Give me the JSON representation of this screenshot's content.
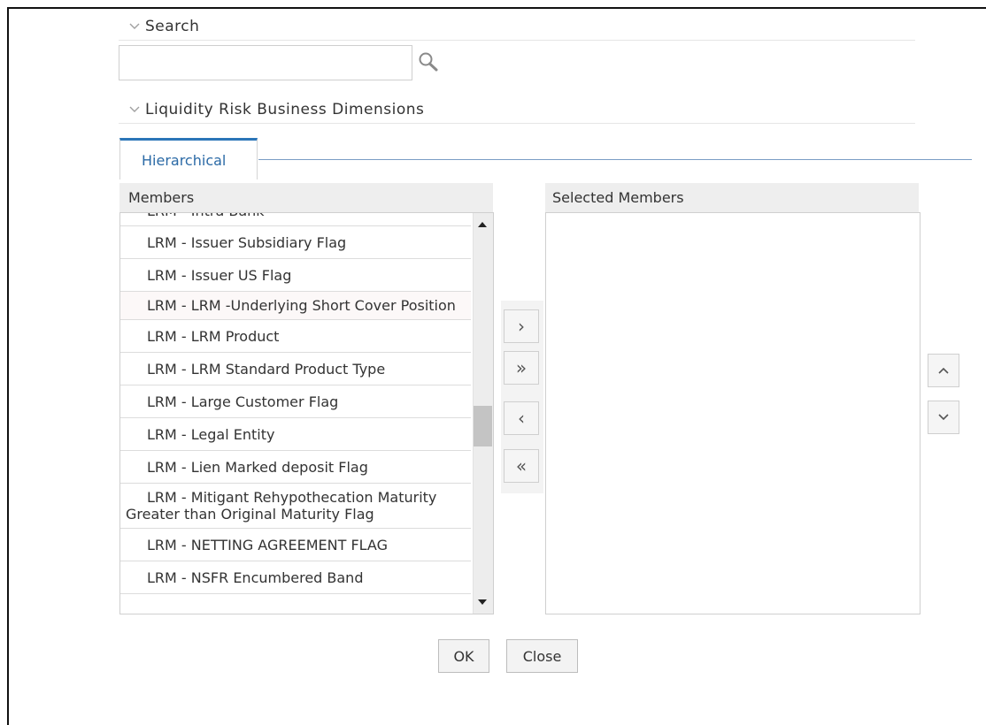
{
  "search_section": {
    "title": "Search",
    "query": "",
    "placeholder": ""
  },
  "dimensions_section": {
    "title": "Liquidity Risk Business Dimensions"
  },
  "tabs": [
    {
      "label": "Hierarchical"
    }
  ],
  "members": {
    "header": "Members",
    "items": [
      "LRM - Intra Bank",
      "LRM - Issuer Subsidiary Flag",
      "LRM - Issuer US Flag",
      "LRM - LRM -Underlying Short Cover Position",
      "LRM - LRM Product",
      "LRM - LRM Standard Product Type",
      "LRM - Large Customer Flag",
      "LRM - Legal Entity",
      "LRM - Lien Marked deposit Flag",
      "LRM - Mitigant Rehypothecation Maturity Greater than Original Maturity Flag",
      "LRM - NETTING AGREEMENT FLAG",
      "LRM - NSFR Encumbered Band"
    ]
  },
  "selected_members": {
    "header": "Selected Members",
    "items": []
  },
  "shuttle": {
    "move": "›",
    "move_all": "»",
    "remove": "‹",
    "remove_all": "«"
  },
  "order": {
    "up": "⌃",
    "down": "⌄"
  },
  "footer": {
    "ok_label": "OK",
    "close_label": "Close"
  },
  "colors": {
    "tab_accent": "#2b75b8",
    "tab_text": "#2b6aa6"
  }
}
